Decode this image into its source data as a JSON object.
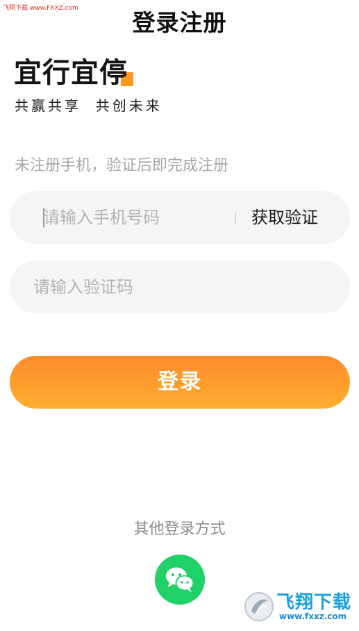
{
  "watermark_top": "飞翔下载 www.FXXZ.com",
  "header": {
    "title": "登录注册"
  },
  "brand": {
    "logo_text": "宜行宜停",
    "slogan": "共赢共享  共创未来",
    "accent_color": "#ff9a1f"
  },
  "form": {
    "hint": "未注册手机，验证后即完成注册",
    "phone": {
      "value": "",
      "placeholder": "请输入手机号码"
    },
    "get_code_label": "获取验证",
    "code": {
      "value": "",
      "placeholder": "请输入验证码"
    },
    "login_label": "登录",
    "login_gradient": [
      "#ff8a2c",
      "#ffaf2e"
    ]
  },
  "alt_login": {
    "label": "其他登录方式",
    "wechat_icon": "wechat-icon",
    "wechat_color": "#1fd166"
  },
  "watermark_br": {
    "text": "飞翔下载",
    "url": "www.fxxz.com"
  }
}
